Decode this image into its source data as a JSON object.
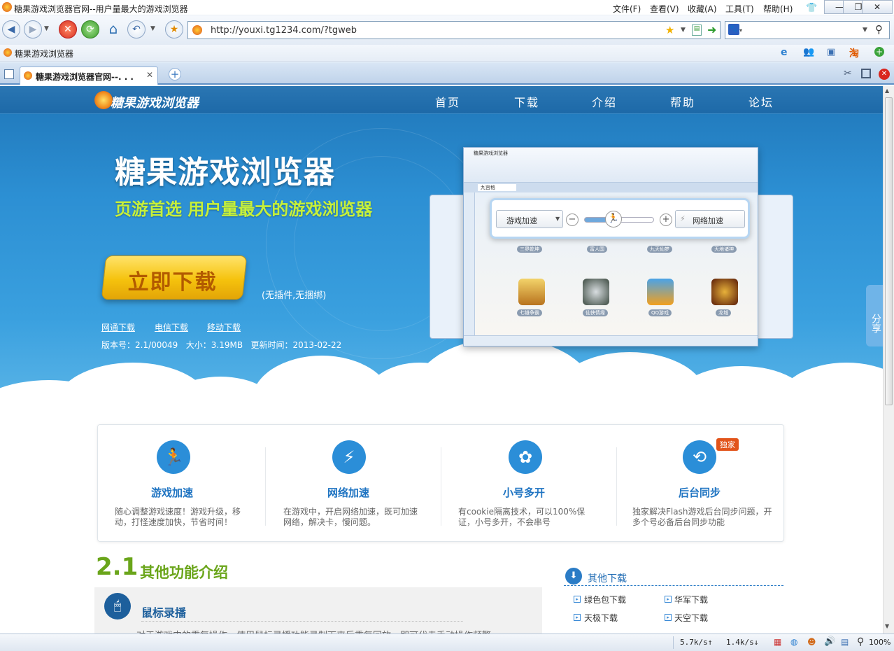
{
  "window": {
    "title": "糖果游戏浏览器官网--用户量最大的游戏浏览器"
  },
  "menu": [
    "文件(F)",
    "查看(V)",
    "收藏(A)",
    "工具(T)",
    "帮助(H)"
  ],
  "address": {
    "url": "http://youxi.tg1234.com/?tgweb"
  },
  "bookmarks": {
    "item": "糖果游戏浏览器"
  },
  "tab": {
    "label": "糖果游戏浏览器官网--. . ."
  },
  "site": {
    "logo": "糖果游戏浏览器",
    "nav": [
      "首页",
      "下载",
      "介绍",
      "帮助",
      "论坛"
    ],
    "hero_title": "糖果游戏浏览器",
    "hero_subtitle": "页游首选 用户量最大的游戏浏览器",
    "download_button": "立即下载",
    "download_note": "(无插件,无捆绑)",
    "links": [
      "网通下载",
      "电信下载",
      "移动下载"
    ],
    "version_info": "版本号：2.1/00049   大小：3.19MB   更新时间：2013-02-22",
    "share": "分享",
    "mock": {
      "title": "糖果游戏浏览器",
      "game_speed": "游戏加速",
      "net_speed": "网络加速",
      "tab": "九宫格",
      "games_top": [
        "三界乾坤",
        "富人国",
        "九天仙梦",
        "天地诸神"
      ],
      "games": [
        "七雄争霸",
        "仙侠情缘",
        "QQ游戏",
        "龙城"
      ]
    },
    "features": [
      {
        "icon": "runner-icon",
        "title": "游戏加速",
        "desc": "随心调整游戏速度！游戏升级，移动，打怪速度加快，节省时间！"
      },
      {
        "icon": "lightning-icon",
        "title": "网络加速",
        "desc": "在游戏中，开启网络加速，既可加速网络，解决卡，慢问题。"
      },
      {
        "icon": "multi-account-icon",
        "title": "小号多开",
        "desc": "有cookie隔离技术，可以100%保证，小号多开，不会串号"
      },
      {
        "icon": "sync-icon",
        "title": "后台同步",
        "desc": "独家解决Flash游戏后台同步问题，开多个号必备后台同步功能",
        "badge": "独家"
      }
    ],
    "section_num": "2.1",
    "section_title": "其他功能介绍",
    "mouse_title": "鼠标录播",
    "mouse_text": "对于游戏中的重复操作，使用鼠标录播功能录制下来后重复回放，即可代走手动操作频繁",
    "other_title": "其他下载",
    "other_links": [
      "绿色包下载",
      "华军下载",
      "天极下载",
      "天空下载"
    ]
  },
  "status": {
    "down": "5.7k/s↑",
    "up": "1.4k/s↓",
    "zoom": "100%"
  }
}
